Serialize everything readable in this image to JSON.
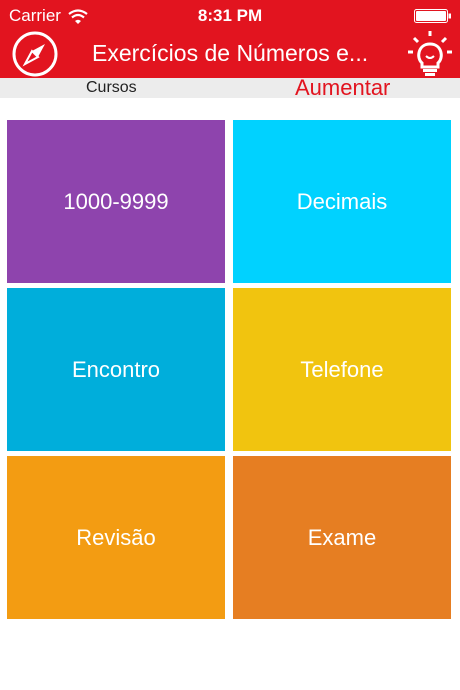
{
  "status_bar": {
    "carrier": "Carrier",
    "time": "8:31 PM",
    "wifi_icon": "wifi-icon",
    "battery_icon": "battery-full-icon"
  },
  "navbar": {
    "title": "Exercícios de Números e...",
    "left_icon": "compass-icon",
    "right_icon": "lightbulb-icon",
    "color": "#e2141f"
  },
  "segments": {
    "cursos": "Cursos",
    "aumentar": "Aumentar",
    "aumentar_color": "#e2141f"
  },
  "tiles": [
    {
      "label": "1000-9999",
      "color": "#8e44ad"
    },
    {
      "label": "Decimais",
      "color": "#00d2ff"
    },
    {
      "label": "Encontro",
      "color": "#00aedb"
    },
    {
      "label": "Telefone",
      "color": "#f1c40f"
    },
    {
      "label": "Revisão",
      "color": "#f39c12"
    },
    {
      "label": "Exame",
      "color": "#e67e22"
    }
  ]
}
